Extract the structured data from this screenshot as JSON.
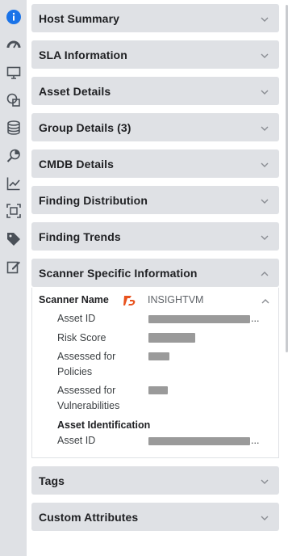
{
  "rail": {
    "icons": [
      "info-icon",
      "gauge-icon",
      "monitor-icon",
      "overlap-shapes-icon",
      "database-icon",
      "search-chart-icon",
      "line-chart-icon",
      "scan-frame-icon",
      "tag-icon",
      "edit-icon"
    ]
  },
  "panels": [
    {
      "label": "Host Summary",
      "expanded": false
    },
    {
      "label": "SLA Information",
      "expanded": false
    },
    {
      "label": "Asset Details",
      "expanded": false
    },
    {
      "label": "Group Details (3)",
      "expanded": false
    },
    {
      "label": "CMDB Details",
      "expanded": false
    },
    {
      "label": "Finding Distribution",
      "expanded": false
    },
    {
      "label": "Finding Trends",
      "expanded": false
    },
    {
      "label": "Scanner Specific Information",
      "expanded": true
    },
    {
      "label": "Tags",
      "expanded": false
    },
    {
      "label": "Custom Attributes",
      "expanded": false
    }
  ],
  "scanner": {
    "scanner_name_label": "Scanner Name",
    "scanner_name_value": "INSIGHTVM",
    "rows": [
      {
        "label": "Asset ID"
      },
      {
        "label": "Risk Score"
      },
      {
        "label_line1": "Assessed for",
        "label_line2": "Policies"
      },
      {
        "label_line1": "Assessed for",
        "label_line2": "Vulnerabilities"
      }
    ],
    "asset_identification_heading": "Asset Identification",
    "asset_identification_row_label": "Asset ID",
    "ellipsis": "..."
  },
  "colors": {
    "rail_bg": "#dfe1e5",
    "panel_bg": "#dfe1e5",
    "accent_blue": "#1a73e8",
    "logo_orange": "#e8531f"
  }
}
